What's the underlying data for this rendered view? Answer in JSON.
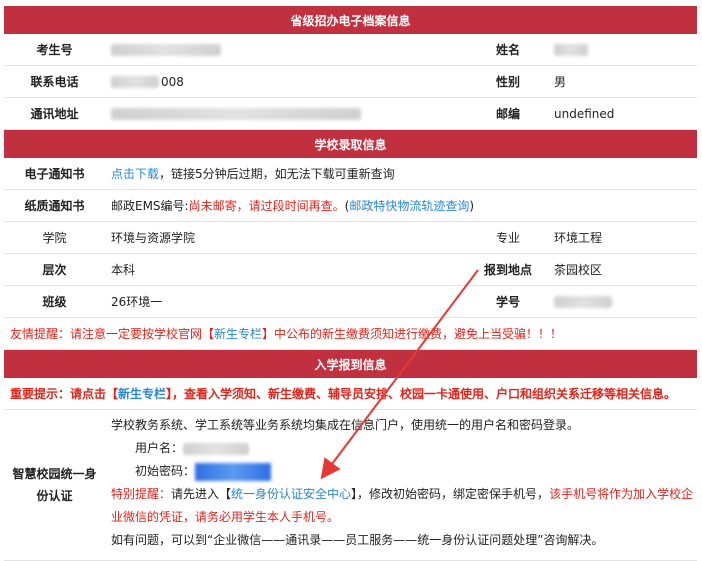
{
  "section1": {
    "title": "省级招办电子档案信息",
    "exam_no_label": "考生号",
    "name_label": "姓名",
    "phone_label": "联系电话",
    "phone_value_tail": "008",
    "gender_label": "性别",
    "gender_value": "男",
    "address_label": "通讯地址",
    "zip_label": "邮编",
    "zip_value": "undefined"
  },
  "section2": {
    "title": "学校录取信息",
    "e_notice_label": "电子通知书",
    "e_notice_link": "点击下载",
    "e_notice_text": "，链接5分钟后过期，如无法下载可重新查询",
    "paper_notice_label": "纸质通知书",
    "ems_prefix": "邮政EMS编号:",
    "ems_status": "尚未邮寄，请过段时间再查。",
    "track_open": "(",
    "track_link": "邮政特快物流轨迹查询",
    "track_close": ")",
    "college_label": "学院",
    "college_value": "环境与资源学院",
    "major_label": "专业",
    "major_value": "环境工程",
    "level_label": "层次",
    "level_value": "本科",
    "report_label": "报到地点",
    "report_value": "茶园校区",
    "class_label": "班级",
    "class_value": "26环境一",
    "student_no_label": "学号",
    "reminder_prefix": "友情提醒：请注意一定要按学校官网【",
    "reminder_link": "新生专栏",
    "reminder_suffix": "】中公布的新生缴费须知进行缴费，避免上当受骗！！！"
  },
  "section3": {
    "title": "入学报到信息",
    "important_prefix": "重要提示：请点击【",
    "important_link": "新生专栏",
    "important_suffix": "】，查看入学须知、新生缴费、辅导员安排、校园一卡通使用、户口和组织关系迁移等相关信息。",
    "sso_label_line1": "智慧校园统一身",
    "sso_label_line2": "份认证",
    "sso_intro": "学校教务系统、学工系统等业务系统均集成在信息门户，使用统一的用户名和密码登录。",
    "username_label": "用户名：",
    "password_label": "初始密码：",
    "special_prefix": "特别提醒：",
    "special_text1": "请先进入【",
    "special_link": "统一身份认证安全中心",
    "special_text2": "】，修改初始密码，绑定密保手机号，",
    "special_red1": "该手机号将作为加入学校企",
    "special_red2": "业微信的凭证，请务必用学生本人手机号。",
    "contact_text": "如有问题，可以到“企业微信——通讯录——员工服务——统一身份认证问题处理”咨询解决。"
  },
  "colors": {
    "header_red": "#c0303e",
    "link_blue": "#2b86d1",
    "alert_red": "#e0241b",
    "arrow_red": "#e53935"
  }
}
